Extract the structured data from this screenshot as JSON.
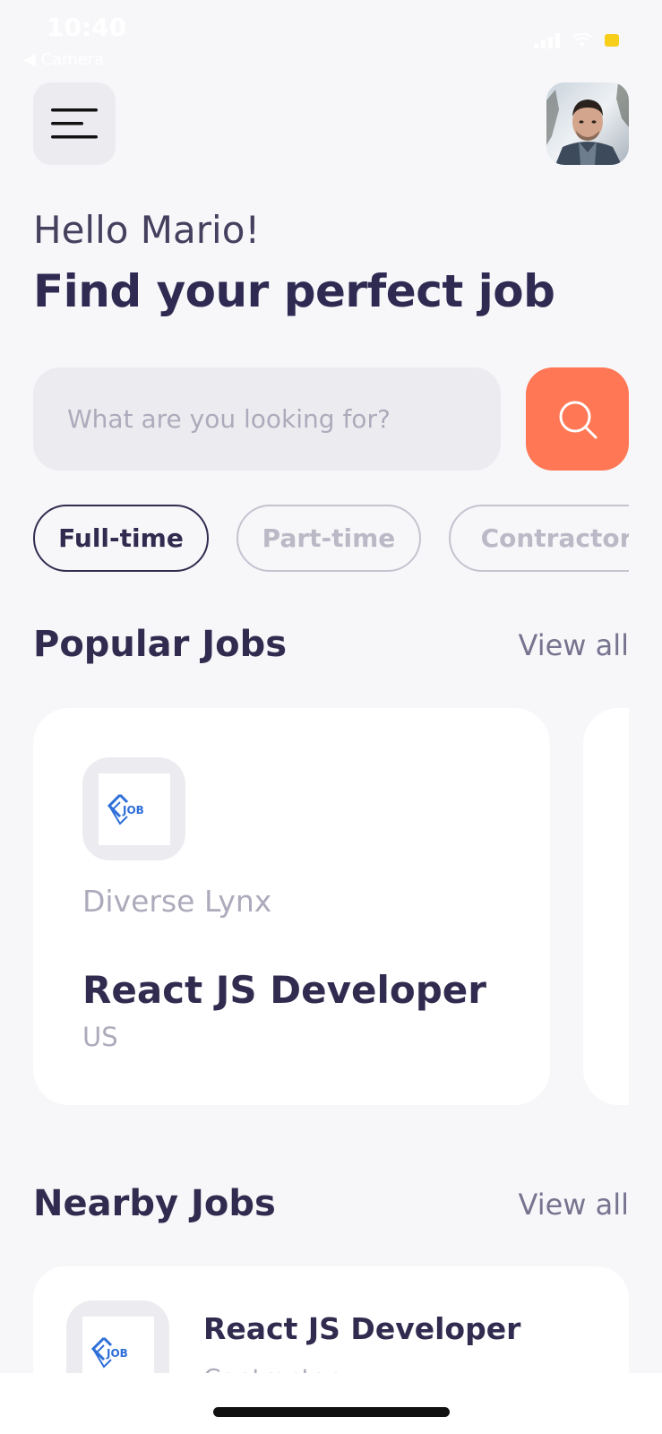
{
  "status_bar": {
    "time": "10:40",
    "back_label": "◀ Camera"
  },
  "header": {
    "menu_icon": "menu-icon",
    "avatar_alt": "profile photo"
  },
  "greeting": "Hello Mario!",
  "headline": "Find your perfect job",
  "search": {
    "placeholder": "What are you looking for?",
    "value": "",
    "button_icon": "search-icon"
  },
  "job_types": [
    {
      "label": "Full-time",
      "active": true
    },
    {
      "label": "Part-time",
      "active": false
    },
    {
      "label": "Contractor",
      "active": false
    }
  ],
  "popular": {
    "title": "Popular Jobs",
    "view_all": "View all",
    "cards": [
      {
        "company": "Diverse Lynx",
        "title": "React JS Developer",
        "location": "US",
        "logo_text": "JOB"
      }
    ]
  },
  "nearby": {
    "title": "Nearby Jobs",
    "view_all": "View all",
    "items": [
      {
        "title": "React JS Developer",
        "type": "Contractor",
        "logo_text": "JOB"
      }
    ]
  },
  "colors": {
    "accent": "#ff7754",
    "primary_text": "#312c4f",
    "muted_text": "#adabbb",
    "background": "#f7f7fa"
  }
}
